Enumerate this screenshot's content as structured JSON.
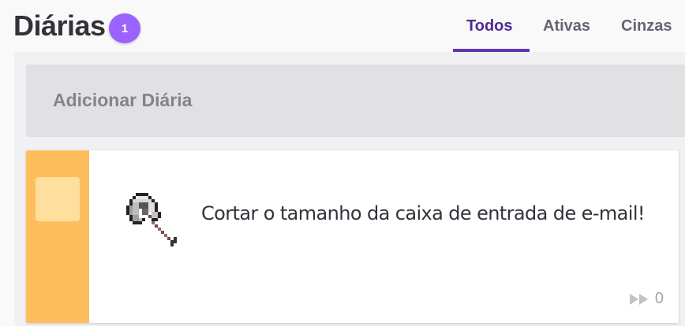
{
  "header": {
    "title": "Diárias",
    "badge_count": "1",
    "tabs": [
      {
        "label": "Todos",
        "active": true
      },
      {
        "label": "Ativas",
        "active": false
      },
      {
        "label": "Cinzas",
        "active": false
      }
    ]
  },
  "add_task": {
    "label": "Adicionar Diária"
  },
  "tasks": [
    {
      "text": "Cortar o tamanho da caixa de entrada de e-mail!",
      "icon": "axe-icon",
      "streak_count": "0",
      "color": "#ffbe5d"
    }
  ],
  "colors": {
    "accent": "#6133b4",
    "badge": "#9a62ff",
    "task_control": "#ffbe5d"
  }
}
